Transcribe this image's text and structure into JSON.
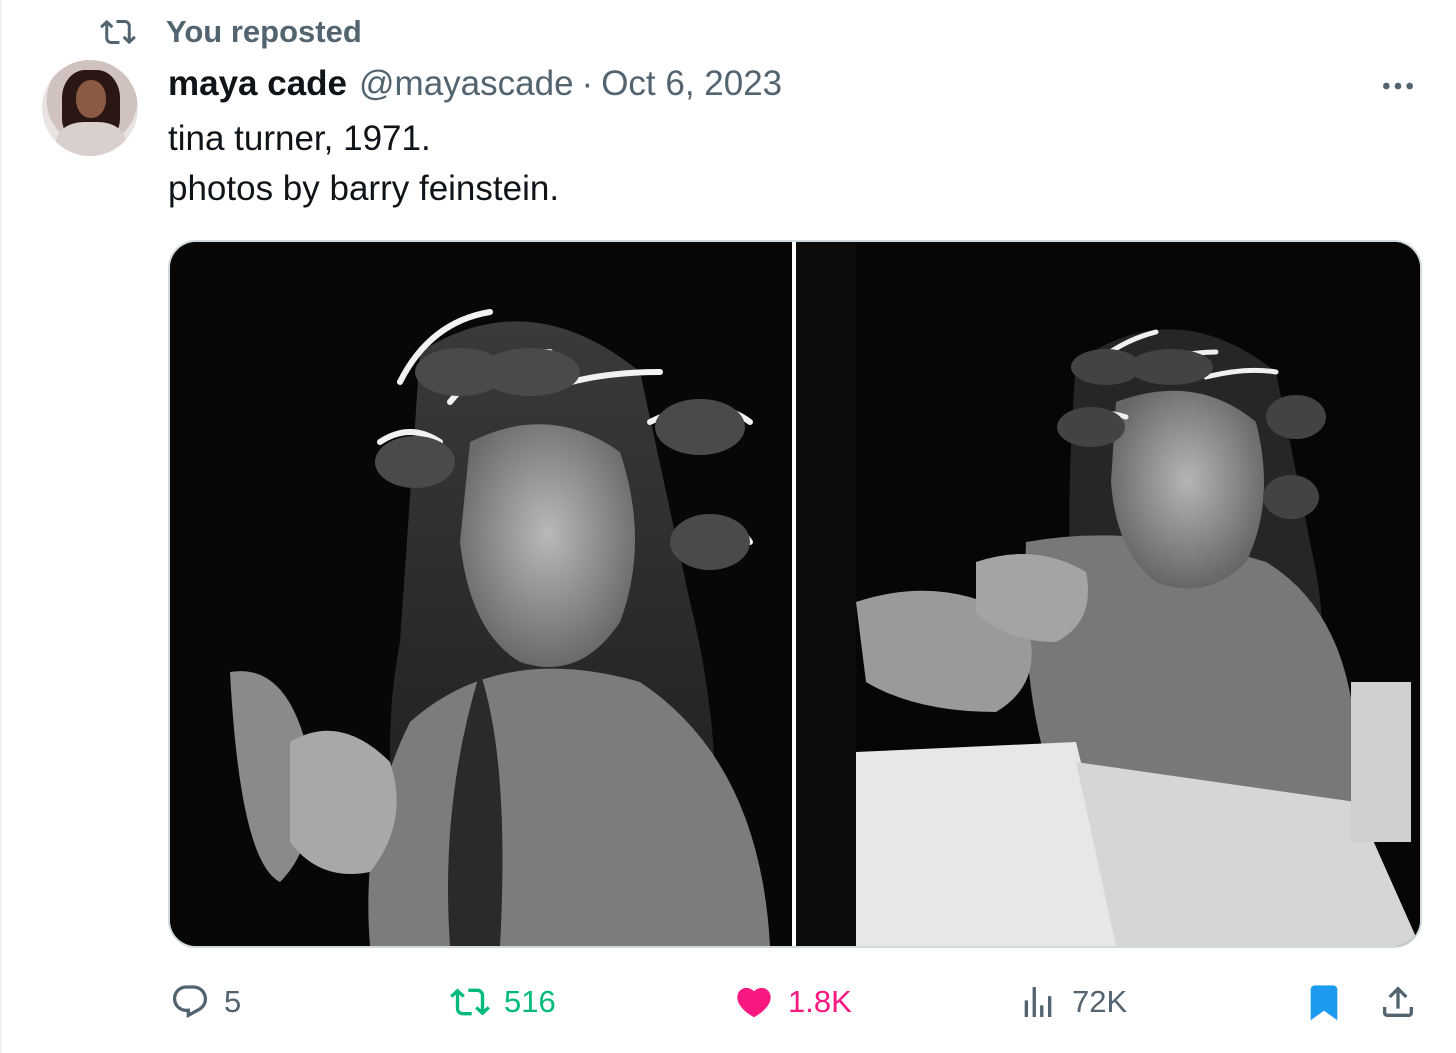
{
  "social_context": {
    "icon": "retweet-icon",
    "text": "You reposted"
  },
  "author": {
    "display_name": "maya cade",
    "handle": "@mayascade",
    "separator": "·",
    "date": "Oct 6, 2023"
  },
  "tweet": {
    "lines": [
      "tina turner, 1971.",
      "photos by barry feinstein."
    ]
  },
  "media": {
    "count": 2,
    "style": "black-and-white photographs"
  },
  "actions": {
    "reply": {
      "icon": "reply-icon",
      "count": "5"
    },
    "retweet": {
      "icon": "retweet-icon",
      "count": "516",
      "active": true
    },
    "like": {
      "icon": "heart-icon",
      "count": "1.8K",
      "active": true
    },
    "views": {
      "icon": "views-chart-icon",
      "count": "72K"
    },
    "bookmark": {
      "icon": "bookmark-icon",
      "active": true
    },
    "share": {
      "icon": "share-icon"
    }
  },
  "colors": {
    "text_primary": "#0f1419",
    "text_secondary": "#536471",
    "retweet_green": "#00ba7c",
    "like_pink": "#f91880",
    "bookmark_blue": "#1d9bf0",
    "border": "#cfd9de"
  }
}
